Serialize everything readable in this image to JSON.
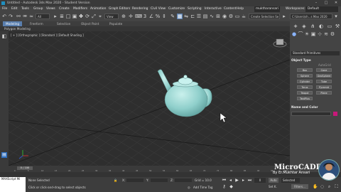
{
  "window": {
    "title": "Untitled - Autodesk 3ds Max 2020 - Student Version",
    "minimize": "–",
    "maximize": "□",
    "close": "✕"
  },
  "menu": [
    "File",
    "Edit",
    "Tools",
    "Group",
    "Views",
    "Create",
    "Modifiers",
    "Animation",
    "Graph Editors",
    "Rendering",
    "Civil View",
    "Customize",
    "Scripting",
    "Interactive",
    "Content",
    "Help"
  ],
  "user": {
    "name": "muktharansari",
    "workspaces_label": "Workspaces:",
    "workspace": "Default"
  },
  "toolbar": {
    "filter": "All",
    "view": "View",
    "selection_set": "Create Selection Se",
    "path": "C:\\Users\\sh...s Max 2020"
  },
  "ribbon": {
    "tabs": [
      "Modeling",
      "Freeform",
      "Selection",
      "Object Paint",
      "Populate"
    ],
    "active": "Modeling",
    "sub": "Polygon Modeling"
  },
  "viewport": {
    "label": "[ + ] [Orthographic ] [Standard ] [Default Shading ]"
  },
  "command_panel": {
    "dropdown": "Standard Primitives",
    "object_type_header": "Object Type",
    "autogrid": "AutoGrid",
    "buttons": [
      "Box",
      "Cone",
      "Sphere",
      "GeoSphere",
      "Cylinder",
      "Tube",
      "Torus",
      "Pyramid",
      "Teapot",
      "Plane",
      "TextPlus"
    ],
    "name_color_header": "Name and Color",
    "color": "#c8187a"
  },
  "timeline": {
    "frame": "0 / 100",
    "ticks": [
      "0",
      "5",
      "10",
      "15",
      "20",
      "25",
      "30",
      "35",
      "40",
      "45",
      "50",
      "55",
      "60",
      "65",
      "70",
      "75",
      "80",
      "85",
      "90",
      "95",
      "100"
    ]
  },
  "status": {
    "maxscript": "MAXScript Mi",
    "selected": "None Selected",
    "hint": "Click or click-and-drag to select objects",
    "x_label": "X:",
    "y_label": "Y:",
    "z_label": "Z:",
    "grid": "Grid = 10.0",
    "add_time_tag": "Add Time Tag",
    "auto": "Auto",
    "selected_dropdown": "Selected",
    "set_k": "Set K.",
    "filters": "Filters...",
    "frame_value": "0"
  },
  "watermark": {
    "title": "MicroCADD",
    "subtitle": "By Er.Mukhtar Ansari"
  },
  "colors": {
    "accent": "#5a7fae",
    "teapot": "#9ad3d0",
    "brand": "#1f8fbf"
  }
}
